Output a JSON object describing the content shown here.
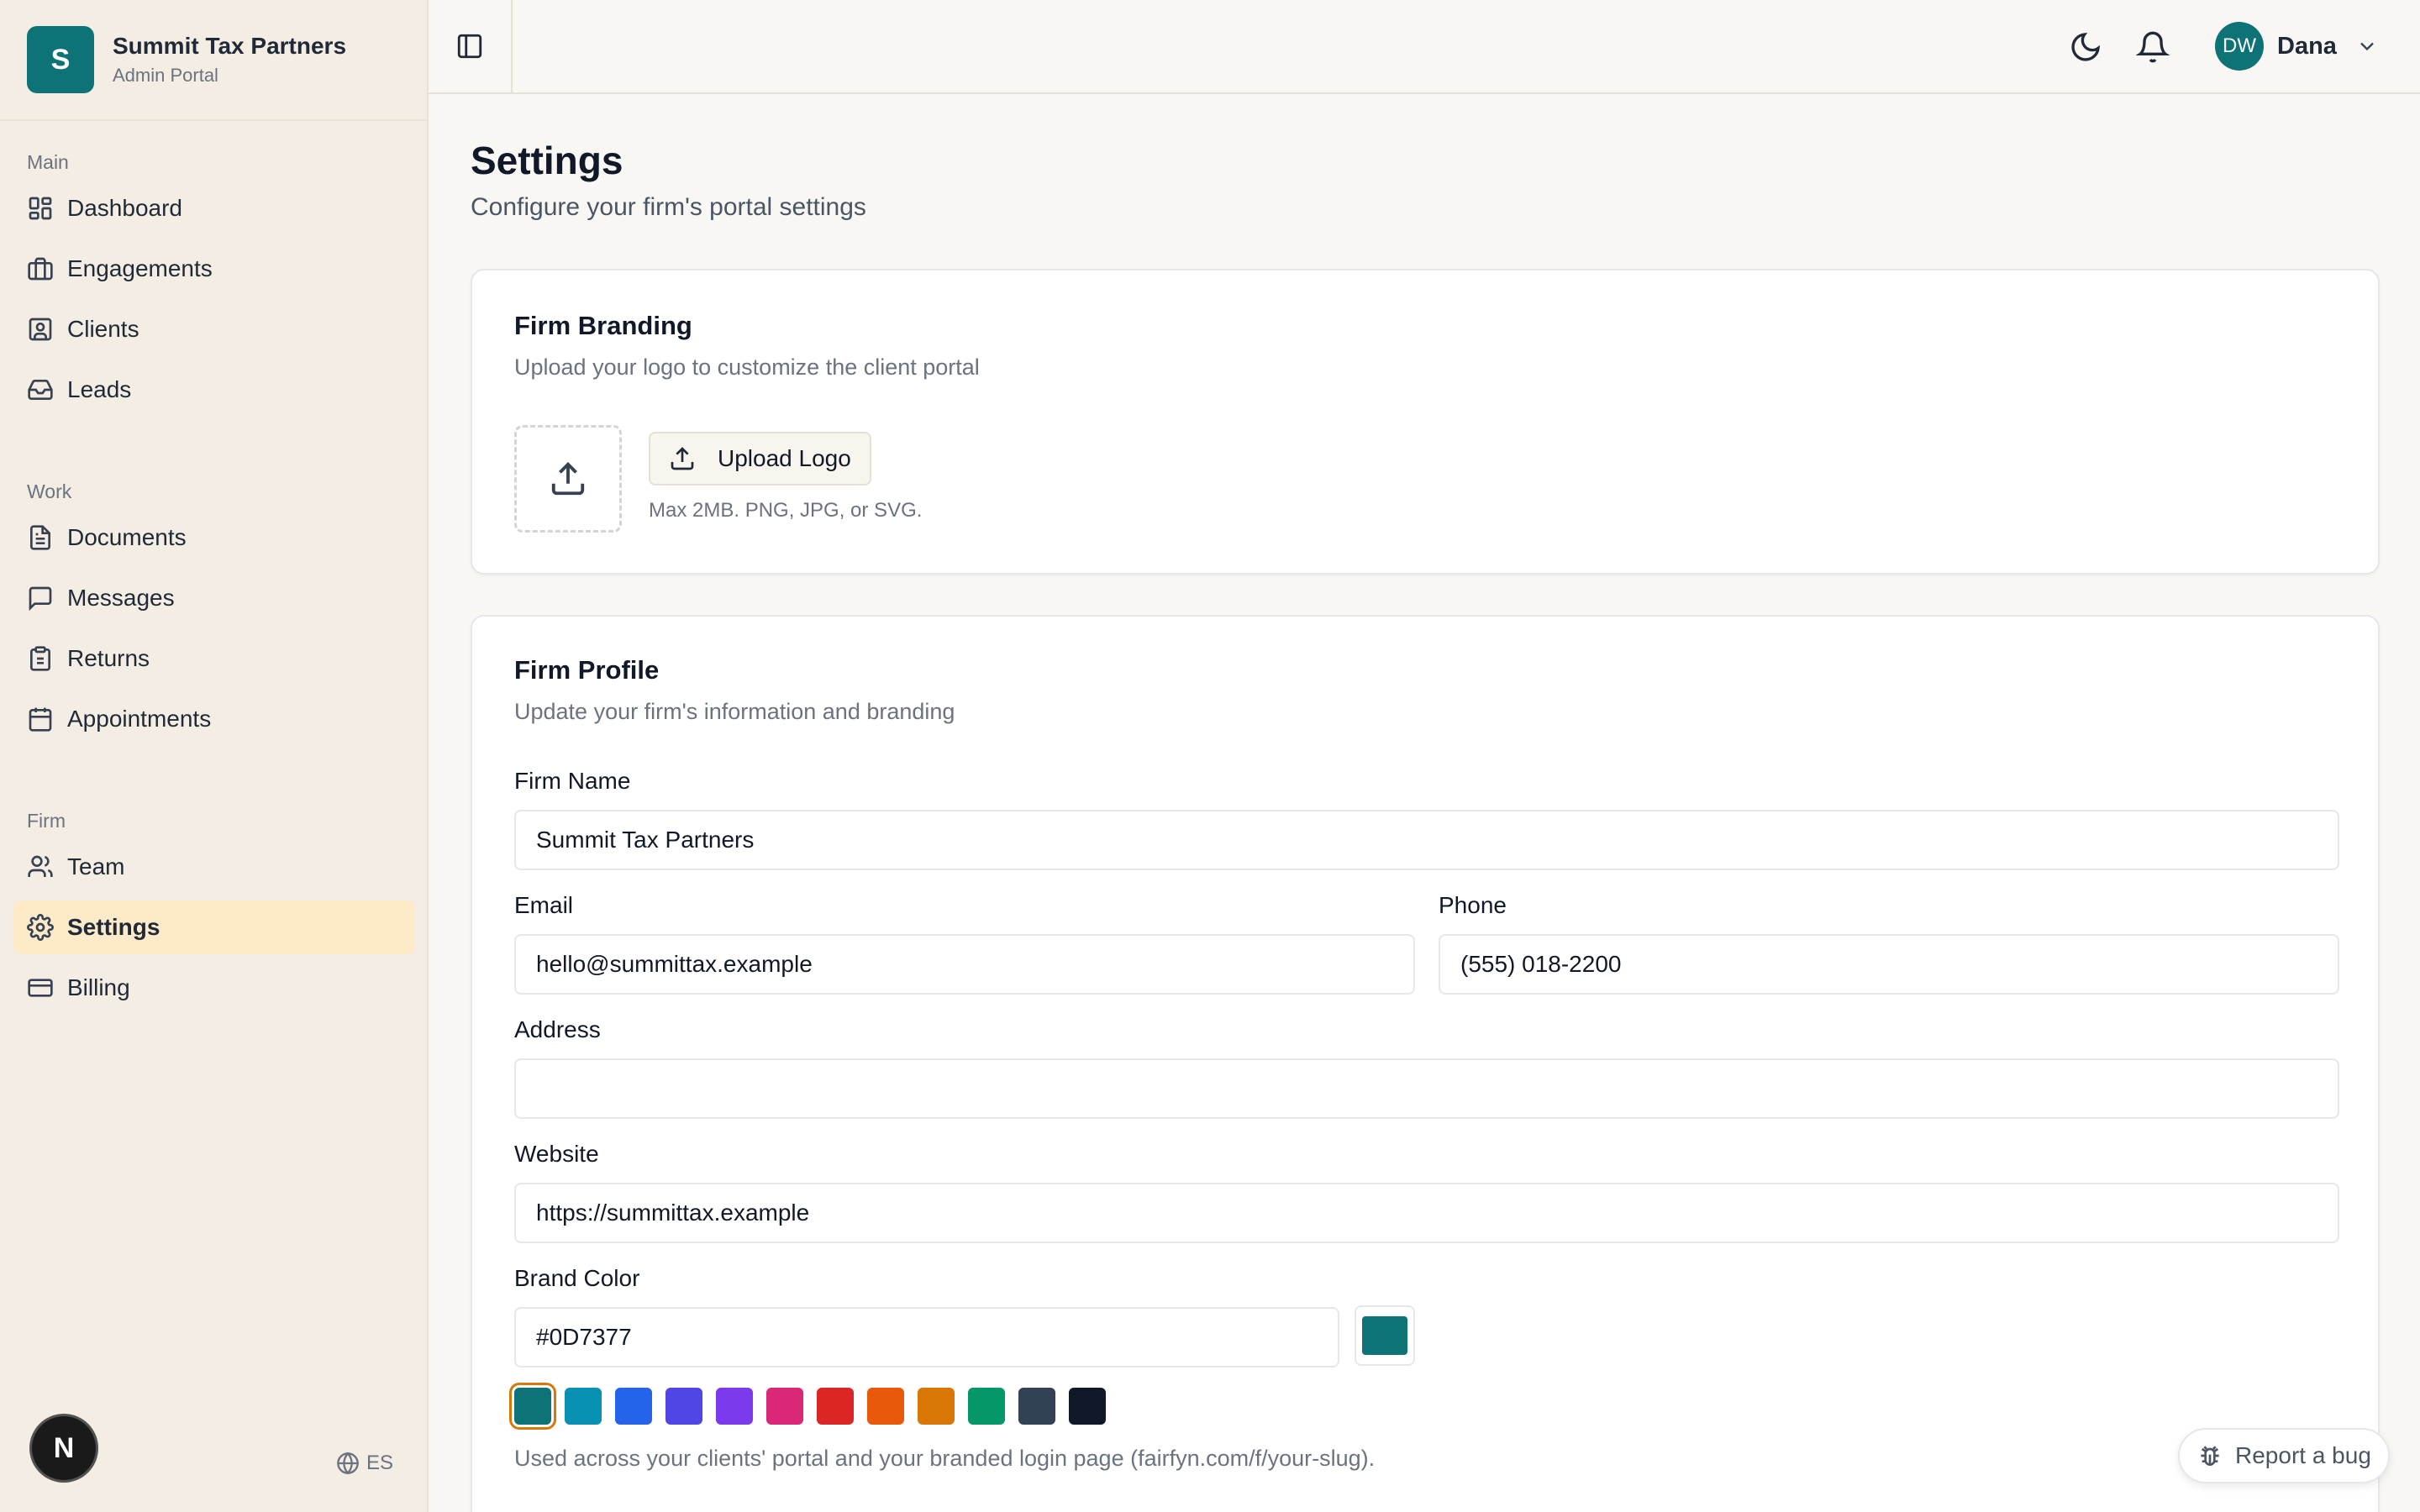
{
  "brand": {
    "initial": "S",
    "name": "Summit Tax Partners",
    "subtitle": "Admin Portal"
  },
  "sidebar": {
    "sections": [
      {
        "heading": "Main",
        "items": [
          {
            "label": "Dashboard",
            "icon": "dashboard-icon"
          },
          {
            "label": "Engagements",
            "icon": "briefcase-icon"
          },
          {
            "label": "Clients",
            "icon": "contact-icon"
          },
          {
            "label": "Leads",
            "icon": "inbox-icon"
          }
        ]
      },
      {
        "heading": "Work",
        "items": [
          {
            "label": "Documents",
            "icon": "document-icon"
          },
          {
            "label": "Messages",
            "icon": "message-icon"
          },
          {
            "label": "Returns",
            "icon": "clipboard-icon"
          },
          {
            "label": "Appointments",
            "icon": "calendar-icon"
          }
        ]
      },
      {
        "heading": "Firm",
        "items": [
          {
            "label": "Team",
            "icon": "users-icon"
          },
          {
            "label": "Settings",
            "icon": "gear-icon",
            "active": true
          },
          {
            "label": "Billing",
            "icon": "credit-card-icon"
          }
        ]
      }
    ]
  },
  "framework_badge": "N",
  "language": "ES",
  "topbar": {
    "user_initials": "DW",
    "user_name": "Dana"
  },
  "page": {
    "title": "Settings",
    "subtitle": "Configure your firm's portal settings"
  },
  "branding_card": {
    "title": "Firm Branding",
    "subtitle": "Upload your logo to customize the client portal",
    "upload_label": "Upload Logo",
    "upload_hint": "Max 2MB. PNG, JPG, or SVG."
  },
  "profile_card": {
    "title": "Firm Profile",
    "subtitle": "Update your firm's information and branding",
    "firm_name_label": "Firm Name",
    "firm_name_value": "Summit Tax Partners",
    "email_label": "Email",
    "email_value": "hello@summittax.example",
    "phone_label": "Phone",
    "phone_value": "(555) 018-2200",
    "address_label": "Address",
    "address_value": "",
    "website_label": "Website",
    "website_value": "https://summittax.example",
    "brand_color_label": "Brand Color",
    "brand_color_value": "#0D7377",
    "swatches": [
      "#0d7377",
      "#0891b2",
      "#2563eb",
      "#4f46e5",
      "#7c3aed",
      "#db2777",
      "#dc2626",
      "#ea580c",
      "#d97706",
      "#059669",
      "#334155",
      "#111827"
    ],
    "selected_swatch": 0,
    "brand_help": "Used across your clients' portal and your branded login page (fairfyn.com/f/your-slug)."
  },
  "report_bug_label": "Report a bug"
}
